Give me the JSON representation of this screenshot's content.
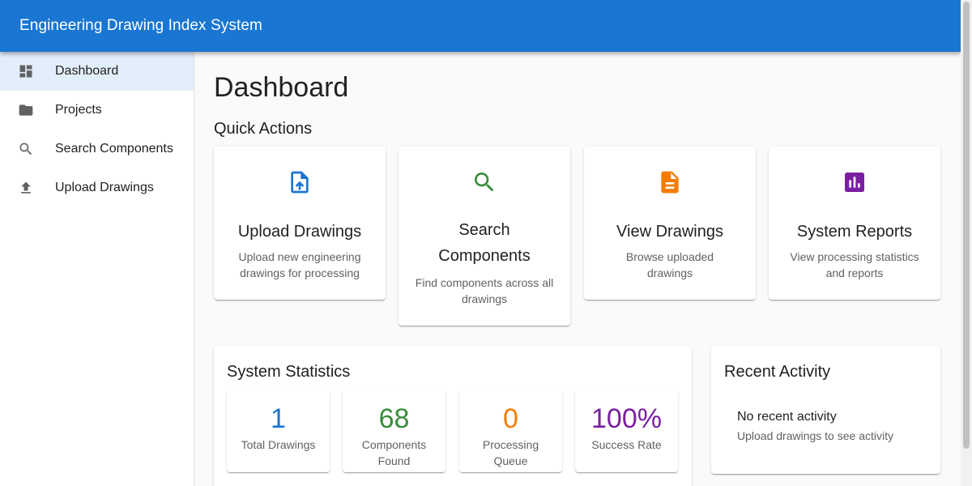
{
  "app": {
    "title": "Engineering Drawing Index System"
  },
  "sidebar": {
    "items": [
      {
        "label": "Dashboard",
        "icon": "dashboard-icon",
        "active": true
      },
      {
        "label": "Projects",
        "icon": "folder-icon"
      },
      {
        "label": "Search Components",
        "icon": "search-icon"
      },
      {
        "label": "Upload Drawings",
        "icon": "upload-icon"
      }
    ]
  },
  "main": {
    "page_title": "Dashboard",
    "quick_actions_title": "Quick Actions",
    "quick_actions": [
      {
        "title": "Upload Drawings",
        "description": "Upload new engineering drawings for processing",
        "icon": "upload-file-icon",
        "color": "#1976d2"
      },
      {
        "title": "Search Components",
        "description": "Find components across all drawings",
        "icon": "search-icon",
        "color": "#388e3c"
      },
      {
        "title": "View Drawings",
        "description": "Browse uploaded drawings",
        "icon": "document-icon",
        "color": "#f57c00"
      },
      {
        "title": "System Reports",
        "description": "View processing statistics and reports",
        "icon": "bar-chart-icon",
        "color": "#7b1fa2"
      }
    ],
    "statistics": {
      "title": "System Statistics",
      "items": [
        {
          "value": "1",
          "label": "Total Drawings",
          "color": "#1976d2"
        },
        {
          "value": "68",
          "label": "Components Found",
          "color": "#388e3c"
        },
        {
          "value": "0",
          "label": "Processing Queue",
          "color": "#f57c00"
        },
        {
          "value": "100%",
          "label": "Success Rate",
          "color": "#7b1fa2"
        }
      ]
    },
    "recent_activity": {
      "title": "Recent Activity",
      "empty_primary": "No recent activity",
      "empty_secondary": "Upload drawings to see activity"
    }
  }
}
